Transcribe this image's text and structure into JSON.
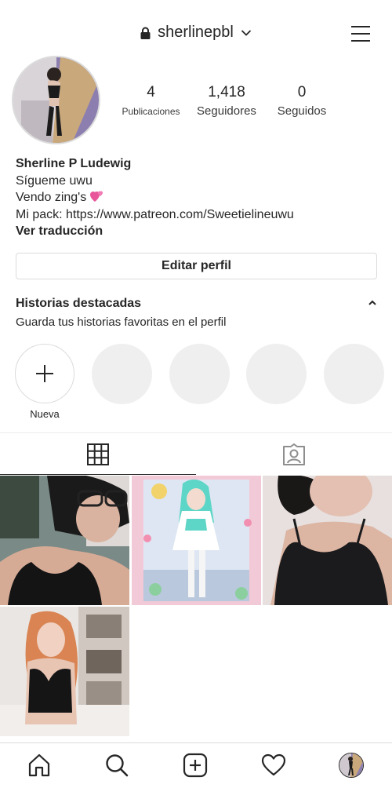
{
  "header": {
    "username": "sherlinepbl",
    "icons": {
      "lock": "lock-icon",
      "chevron": "chevron-down-icon",
      "menu": "hamburger-menu-icon"
    }
  },
  "profile": {
    "stats": {
      "posts_count": "4",
      "posts_label": "Publicaciones",
      "followers_count": "1,418",
      "followers_label": "Seguidores",
      "following_count": "0",
      "following_label": "Seguidos"
    },
    "bio": {
      "name": "Sherline P Ludewig",
      "line1": "Sígueme uwu",
      "line2": "Vendo zing's",
      "line2_emoji": "two-hearts-emoji",
      "line3": "Mi pack: https://www.patreon.com/Sweetielineuwu",
      "translate": "Ver traducción"
    },
    "edit_button": "Editar perfil"
  },
  "highlights": {
    "title": "Historias destacadas",
    "subtitle": "Guarda tus historias favoritas en el perfil",
    "new_label": "Nueva"
  },
  "tabs": [
    {
      "name": "grid-icon",
      "active": true
    },
    {
      "name": "tagged-icon",
      "active": false
    }
  ],
  "posts": [
    {
      "name": "post-photo-1"
    },
    {
      "name": "post-photo-2"
    },
    {
      "name": "post-photo-3"
    },
    {
      "name": "post-photo-4"
    }
  ],
  "bottom_nav": [
    {
      "name": "home-icon"
    },
    {
      "name": "search-icon"
    },
    {
      "name": "new-post-icon"
    },
    {
      "name": "activity-heart-icon"
    },
    {
      "name": "profile-avatar"
    }
  ],
  "colors": {
    "text": "#262626",
    "border": "#dbdbdb",
    "placeholder": "#efefef",
    "heart_emoji": "#e8559a"
  }
}
